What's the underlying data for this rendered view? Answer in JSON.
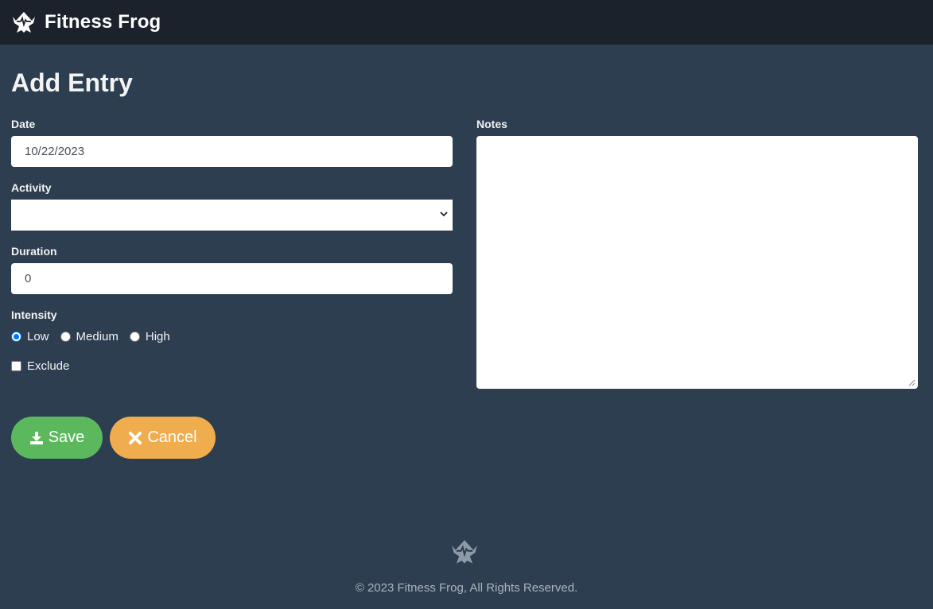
{
  "header": {
    "brand_name": "Fitness Frog",
    "logo_icon": "frog-logo-icon"
  },
  "page": {
    "title": "Add Entry"
  },
  "form": {
    "date": {
      "label": "Date",
      "value": "10/22/2023"
    },
    "activity": {
      "label": "Activity",
      "value": ""
    },
    "duration": {
      "label": "Duration",
      "value": "0"
    },
    "intensity": {
      "label": "Intensity",
      "options": [
        "Low",
        "Medium",
        "High"
      ],
      "selected": "Low"
    },
    "exclude": {
      "label": "Exclude",
      "checked": false
    },
    "notes": {
      "label": "Notes",
      "value": ""
    }
  },
  "buttons": {
    "save_label": "Save",
    "save_icon": "download-icon",
    "cancel_label": "Cancel",
    "cancel_icon": "close-icon"
  },
  "footer": {
    "text": "© 2023 Fitness Frog, All Rights Reserved.",
    "logo_icon": "frog-logo-icon"
  },
  "colors": {
    "navbar": "#1b222b",
    "page_background": "#2c3e50",
    "save_button": "#5cb85c",
    "cancel_button": "#f0ad4e"
  }
}
